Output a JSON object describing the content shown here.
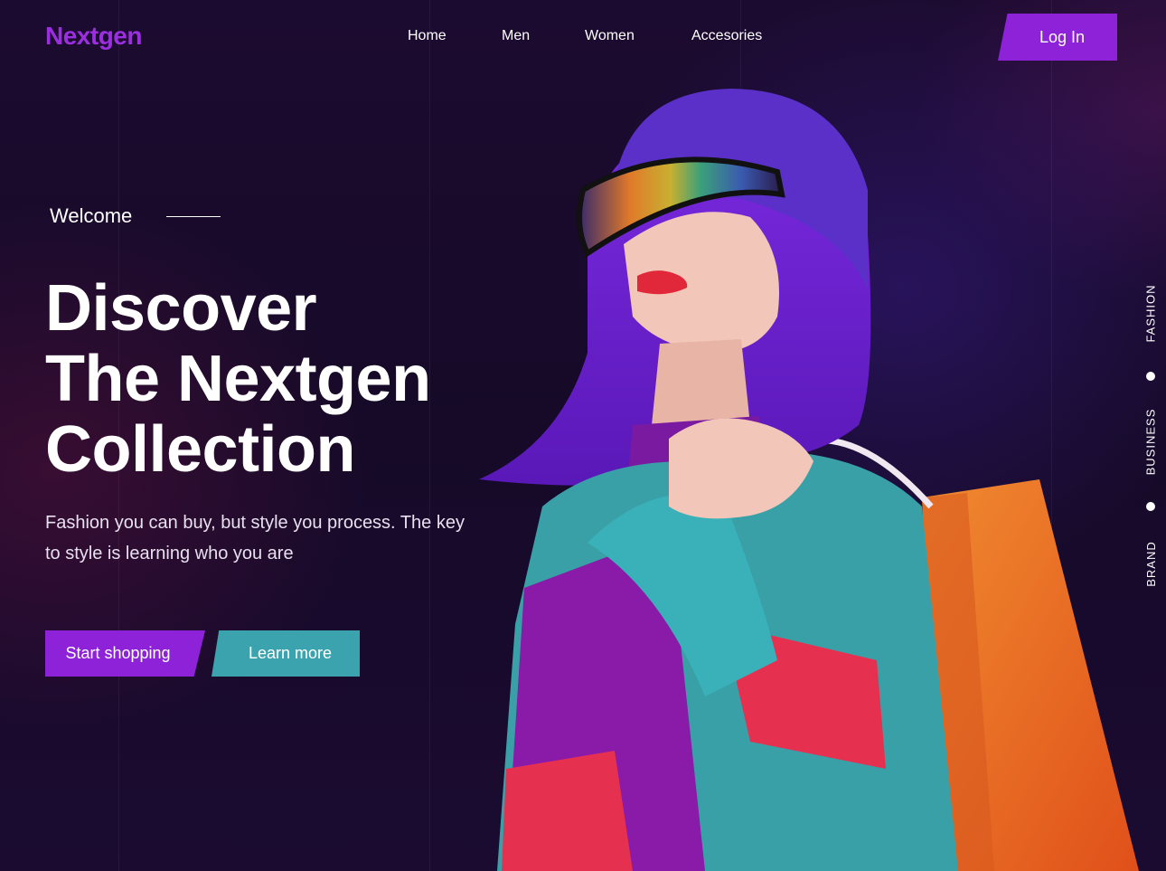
{
  "brand": {
    "logo": "Nextgen",
    "accent_color": "#8e22d9",
    "secondary_color": "#3ba3ad"
  },
  "nav": {
    "items": [
      {
        "label": "Home"
      },
      {
        "label": "Men"
      },
      {
        "label": "Women"
      },
      {
        "label": "Accesories"
      }
    ],
    "login_label": "Log In"
  },
  "hero": {
    "welcome": "Welcome",
    "headline_lines": [
      "Discover",
      "The Nextgen",
      "Collection"
    ],
    "subtext": "Fashion you can buy, but style you process. The key to style is learning who you are",
    "primary_cta": "Start shopping",
    "secondary_cta": "Learn more"
  },
  "side_nav": {
    "items": [
      {
        "label": "FASHION"
      },
      {
        "label": "BUSINESS"
      },
      {
        "label": "BRAND"
      }
    ]
  },
  "icons": [
    "model-photo",
    "dot-indicator"
  ]
}
